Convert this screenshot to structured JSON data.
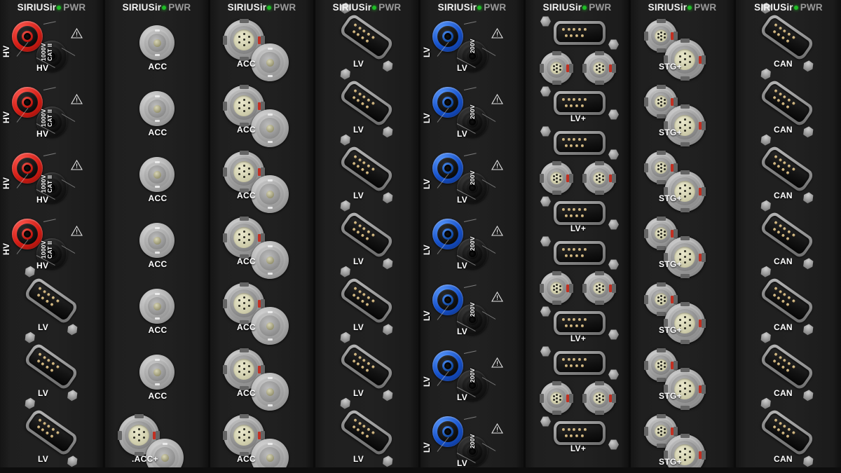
{
  "device": {
    "brand_main": "SIRIUSir",
    "brand_sub": "PWR",
    "status_dot_color": "#1fbd26",
    "panel_color": "#1e1e1e",
    "divider_color": "#0b0b0b"
  },
  "labels": {
    "hv": "HV",
    "lv": "LV",
    "lv_plus": "LV+",
    "acc": "ACC",
    "acc_plus": ".ACC+",
    "stg_plus": "STG+",
    "can": "CAN",
    "rating_1000v_line1": "1000V",
    "rating_1000v_line2": "CAT II",
    "rating_200v": "200V",
    "warning_icon": "warning-triangle-icon"
  },
  "columns": [
    {
      "index": 1,
      "header_main": "SIRIUSir",
      "header_sub": "PWR",
      "module_type": "high-voltage-module",
      "channels": [
        {
          "kind": "banana-pair",
          "label": "HV",
          "rating": "1000V CAT II",
          "color": "#d31d15",
          "color_name": "red"
        },
        {
          "kind": "banana-pair",
          "label": "HV",
          "rating": "1000V CAT II",
          "color": "#d31d15",
          "color_name": "red"
        },
        {
          "kind": "banana-pair",
          "label": "HV",
          "rating": "1000V CAT II",
          "color": "#d31d15",
          "color_name": "red"
        },
        {
          "kind": "banana-pair",
          "label": "HV",
          "rating": "1000V CAT II",
          "color": "#d31d15",
          "color_name": "red"
        },
        {
          "kind": "db9",
          "label": "LV"
        },
        {
          "kind": "db9",
          "label": "LV"
        },
        {
          "kind": "db9",
          "label": "LV"
        }
      ]
    },
    {
      "index": 2,
      "header_main": "SIRIUSir",
      "header_sub": "PWR",
      "module_type": "bnc-accelerometer-module",
      "channels": [
        {
          "kind": "bnc",
          "label": "ACC"
        },
        {
          "kind": "bnc",
          "label": "ACC"
        },
        {
          "kind": "bnc",
          "label": "ACC"
        },
        {
          "kind": "bnc",
          "label": "ACC"
        },
        {
          "kind": "bnc",
          "label": "ACC"
        },
        {
          "kind": "bnc",
          "label": "ACC"
        },
        {
          "kind": "lemo-bnc",
          "label": ".ACC+"
        }
      ]
    },
    {
      "index": 3,
      "header_main": "SIRIUSir",
      "header_sub": "PWR",
      "module_type": "lemo-bnc-accelerometer-module",
      "channels": [
        {
          "kind": "lemo-bnc",
          "label": "ACC"
        },
        {
          "kind": "lemo-bnc",
          "label": "ACC"
        },
        {
          "kind": "lemo-bnc",
          "label": "ACC"
        },
        {
          "kind": "lemo-bnc",
          "label": "ACC"
        },
        {
          "kind": "lemo-bnc",
          "label": "ACC"
        },
        {
          "kind": "lemo-bnc",
          "label": "ACC"
        },
        {
          "kind": "lemo-bnc",
          "label": "ACC"
        }
      ]
    },
    {
      "index": 4,
      "header_main": "SIRIUSir",
      "header_sub": "PWR",
      "module_type": "low-voltage-db9-module",
      "channels": [
        {
          "kind": "db9",
          "label": "LV"
        },
        {
          "kind": "db9",
          "label": "LV"
        },
        {
          "kind": "db9",
          "label": "LV"
        },
        {
          "kind": "db9",
          "label": "LV"
        },
        {
          "kind": "db9",
          "label": "LV"
        },
        {
          "kind": "db9",
          "label": "LV"
        },
        {
          "kind": "db9",
          "label": "LV"
        }
      ]
    },
    {
      "index": 5,
      "header_main": "SIRIUSir",
      "header_sub": "PWR",
      "module_type": "low-voltage-banana-module",
      "channels": [
        {
          "kind": "banana-pair",
          "label": "LV",
          "rating": "200V",
          "color": "#1550c9",
          "color_name": "blue"
        },
        {
          "kind": "banana-pair",
          "label": "LV",
          "rating": "200V",
          "color": "#1550c9",
          "color_name": "blue"
        },
        {
          "kind": "banana-pair",
          "label": "LV",
          "rating": "200V",
          "color": "#1550c9",
          "color_name": "blue"
        },
        {
          "kind": "banana-pair",
          "label": "LV",
          "rating": "200V",
          "color": "#1550c9",
          "color_name": "blue"
        },
        {
          "kind": "banana-pair",
          "label": "LV",
          "rating": "200V",
          "color": "#1550c9",
          "color_name": "blue"
        },
        {
          "kind": "banana-pair",
          "label": "LV",
          "rating": "200V",
          "color": "#1550c9",
          "color_name": "blue"
        },
        {
          "kind": "banana-pair",
          "label": "LV",
          "rating": "200V",
          "color": "#1550c9",
          "color_name": "blue"
        }
      ]
    },
    {
      "index": 6,
      "header_main": "SIRIUSir",
      "header_sub": "PWR",
      "module_type": "low-voltage-plus-module",
      "channels": [
        {
          "kind": "db9-lemo-db9",
          "label": "LV+"
        },
        {
          "kind": "db9-lemo-db9",
          "label": "LV+"
        },
        {
          "kind": "db9-lemo-db9",
          "label": "LV+"
        },
        {
          "kind": "db9-lemo-db9",
          "label": "LV+"
        }
      ]
    },
    {
      "index": 7,
      "header_main": "SIRIUSir",
      "header_sub": "PWR",
      "module_type": "strain-gauge-module",
      "channels": [
        {
          "kind": "lemo-pair",
          "label": "STG+"
        },
        {
          "kind": "lemo-pair",
          "label": "STG+"
        },
        {
          "kind": "lemo-pair",
          "label": "STG+"
        },
        {
          "kind": "lemo-pair",
          "label": "STG+"
        },
        {
          "kind": "lemo-pair",
          "label": "STG+"
        },
        {
          "kind": "lemo-pair",
          "label": "STG+"
        },
        {
          "kind": "lemo-pair",
          "label": "STG+"
        }
      ]
    },
    {
      "index": 8,
      "header_main": "SIRIUSir",
      "header_sub": "PWR",
      "module_type": "can-bus-module",
      "channels": [
        {
          "kind": "db9",
          "label": "CAN"
        },
        {
          "kind": "db9",
          "label": "CAN"
        },
        {
          "kind": "db9",
          "label": "CAN"
        },
        {
          "kind": "db9",
          "label": "CAN"
        },
        {
          "kind": "db9",
          "label": "CAN"
        },
        {
          "kind": "db9",
          "label": "CAN"
        },
        {
          "kind": "db9",
          "label": "CAN"
        }
      ]
    }
  ]
}
